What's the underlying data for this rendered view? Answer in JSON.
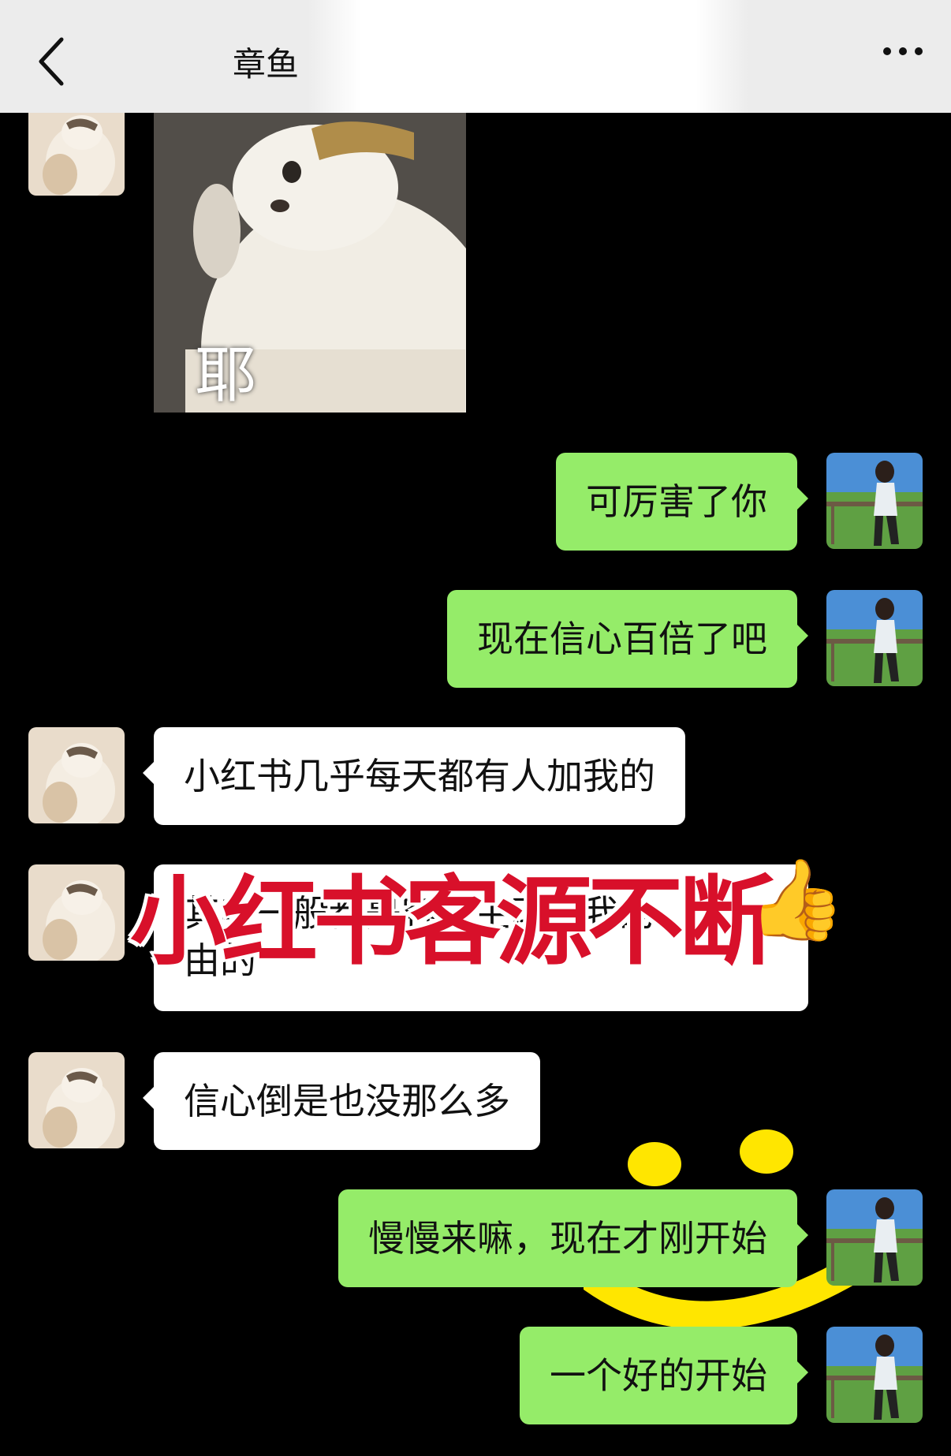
{
  "header": {
    "title": "章鱼"
  },
  "sticker": {
    "caption": "耶"
  },
  "messages": [
    {
      "side": "right",
      "text": "可厉害了你"
    },
    {
      "side": "right",
      "text": "现在信心百倍了吧"
    },
    {
      "side": "left",
      "text": "小红书几乎每天都有人加我的"
    },
    {
      "side": "left",
      "text_line1": "其实一般都是客户主动找我的",
      "text_line2": "由的"
    },
    {
      "side": "left",
      "text": "信心倒是也没那么多"
    },
    {
      "side": "right",
      "text": "慢慢来嘛，现在才刚开始"
    },
    {
      "side": "right",
      "text": "一个好的开始"
    }
  ],
  "overlay": {
    "banner": "小红书客源不断",
    "thumb": "👍"
  },
  "colors": {
    "outgoing": "#95ec69",
    "incoming": "#ffffff",
    "background": "#000000",
    "banner": "#d8102a",
    "smiley": "#ffe600"
  }
}
